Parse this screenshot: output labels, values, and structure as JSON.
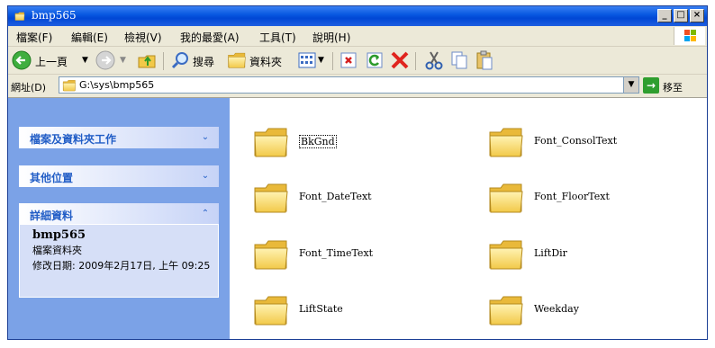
{
  "window": {
    "title": "bmp565"
  },
  "menu": [
    {
      "label": "檔案(F)"
    },
    {
      "label": "編輯(E)"
    },
    {
      "label": "檢視(V)"
    },
    {
      "label": "我的最愛(A)"
    },
    {
      "label": "工具(T)"
    },
    {
      "label": "說明(H)"
    }
  ],
  "toolbar": {
    "back": "上一頁",
    "search": "搜尋",
    "folders": "資料夾"
  },
  "address": {
    "label": "網址(D)",
    "path": "G:\\sys\\bmp565",
    "go": "移至"
  },
  "tasks": {
    "panel1": "檔案及資料夾工作",
    "panel2": "其他位置",
    "panel3": "詳細資料",
    "details": {
      "name": "bmp565",
      "type": "檔案資料夾",
      "modified": "修改日期: 2009年2月17日, 上午 09:25"
    }
  },
  "files": [
    {
      "name": "BkGnd",
      "selected": true
    },
    {
      "name": "Font_ConsolText"
    },
    {
      "name": "Font_DateText"
    },
    {
      "name": "Font_FloorText"
    },
    {
      "name": "Font_TimeText"
    },
    {
      "name": "LiftDir"
    },
    {
      "name": "LiftState"
    },
    {
      "name": "Weekday"
    }
  ],
  "colors": {
    "titlebar": "#0a5ae2",
    "taskpane": "#7ba2e7",
    "folder": "#f7d56b"
  }
}
